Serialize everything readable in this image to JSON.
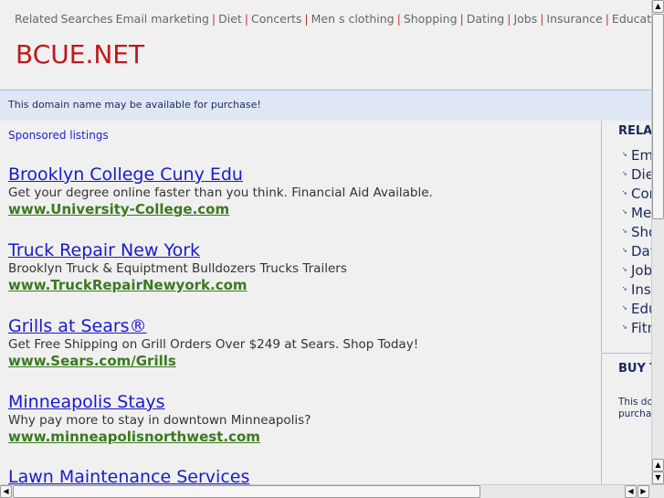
{
  "top_links": {
    "label": "Related Searches",
    "items": [
      "Email marketing",
      "Diet",
      "Concerts",
      "Men s clothing",
      "Shopping",
      "Dating",
      "Jobs",
      "Insurance",
      "Educat"
    ]
  },
  "logo": "BCUE.NET",
  "banner": "This domain name may be available for purchase!",
  "sponsored": "Sponsored listings",
  "ads": [
    {
      "title": "Brooklyn College Cuny Edu",
      "desc": "Get your degree online faster than you think. Financial Aid Available.",
      "url": "www.University-College.com"
    },
    {
      "title": "Truck Repair New York",
      "desc": "Brooklyn Truck & Equiptment Bulldozers Trucks Trailers",
      "url": "www.TruckRepairNewyork.com"
    },
    {
      "title": "Grills at Sears®",
      "desc": "Get Free Shipping on Grill Orders Over $249 at Sears. Shop Today!",
      "url": "www.Sears.com/Grills"
    },
    {
      "title": "Minneapolis Stays",
      "desc": "Why pay more to stay in downtown Minneapolis?",
      "url": "www.minneapolisnorthwest.com"
    },
    {
      "title": "Lawn Maintenance Services",
      "desc": "",
      "url": ""
    }
  ],
  "sidebar": {
    "heading": "RELA",
    "items": [
      "Em",
      "Die",
      "Cor",
      "Mer",
      "Sho",
      "Dat",
      "Job",
      "Ins",
      "Edu",
      "Fitn"
    ],
    "buy_heading": "BUY T",
    "buy_text_1": "This do",
    "buy_text_2": "purcha"
  }
}
